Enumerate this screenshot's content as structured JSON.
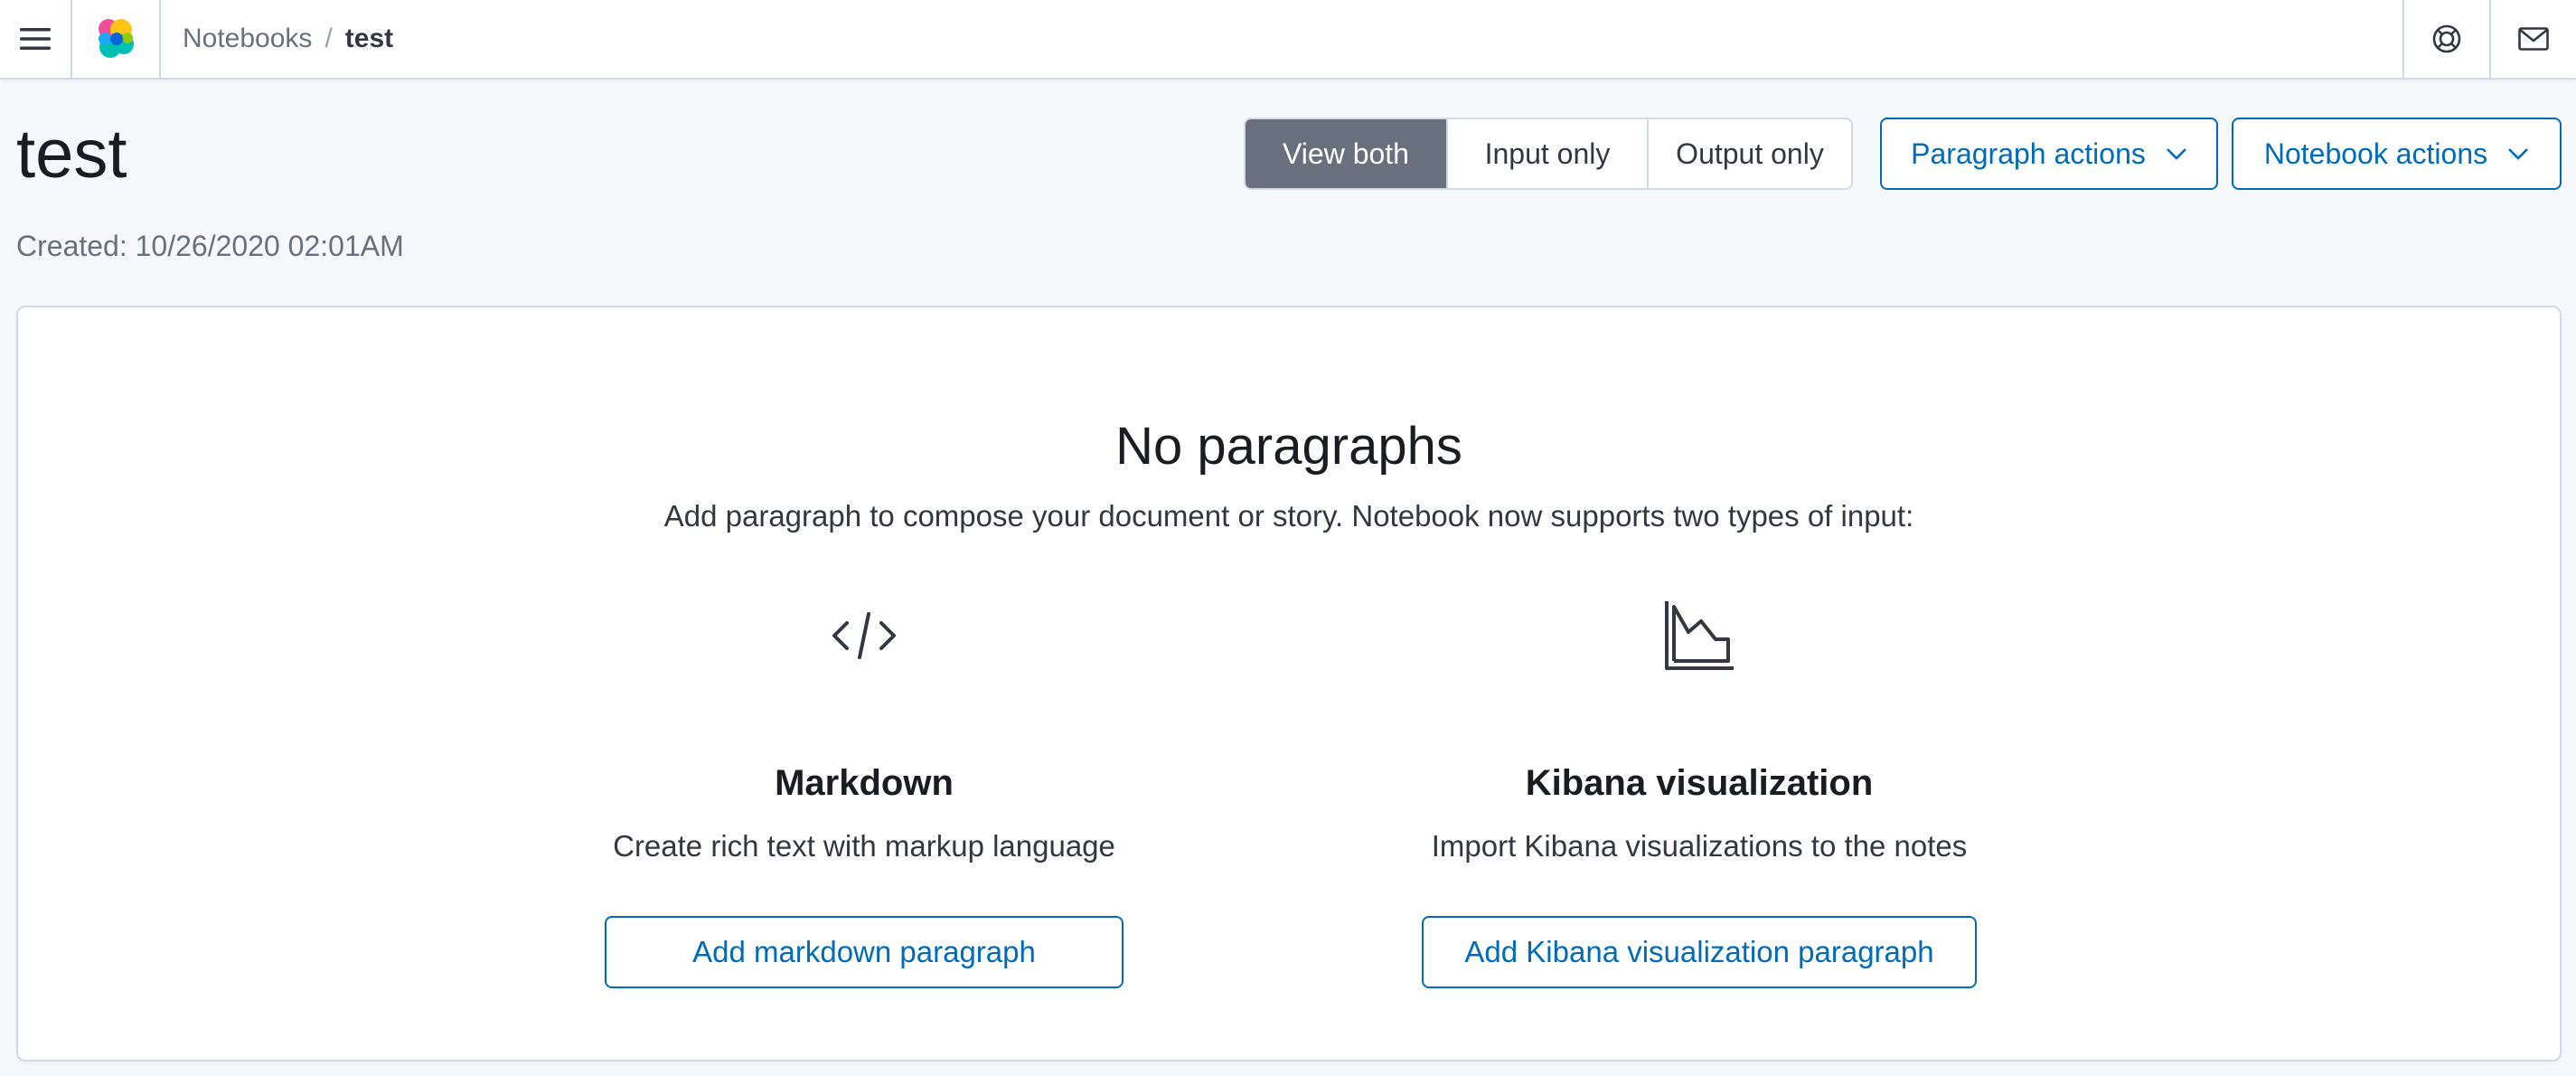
{
  "header": {
    "menu_icon": "hamburger-menu-icon",
    "logo_icon": "elastic-logo-icon",
    "breadcrumbs": [
      {
        "label": "Notebooks"
      },
      {
        "label": "test"
      }
    ],
    "breadcrumb_separator": "/",
    "help_icon": "help-lifebuoy-icon",
    "mail_icon": "mail-icon"
  },
  "page": {
    "title": "test",
    "created": "Created: 10/26/2020 02:01AM"
  },
  "view_toggle": {
    "options": [
      "View both",
      "Input only",
      "Output only"
    ],
    "selected": "View both"
  },
  "actions": {
    "paragraph_actions": "Paragraph actions",
    "notebook_actions": "Notebook actions",
    "chevron_icon": "chevron-down-icon"
  },
  "empty_state": {
    "title": "No paragraphs",
    "description": "Add paragraph to compose your document or story. Notebook now supports two types of input:",
    "options": [
      {
        "icon": "code-icon",
        "title": "Markdown",
        "description": "Create rich text with markup language",
        "button": "Add markdown paragraph"
      },
      {
        "icon": "visualization-chart-icon",
        "title": "Kibana visualization",
        "description": "Import Kibana visualizations to the notes",
        "button": "Add Kibana visualization paragraph"
      }
    ]
  },
  "colors": {
    "accent": "#006bb8",
    "selected_toggle": "#69707d",
    "border": "#d3dae6",
    "page_background": "#f7f8fc"
  }
}
